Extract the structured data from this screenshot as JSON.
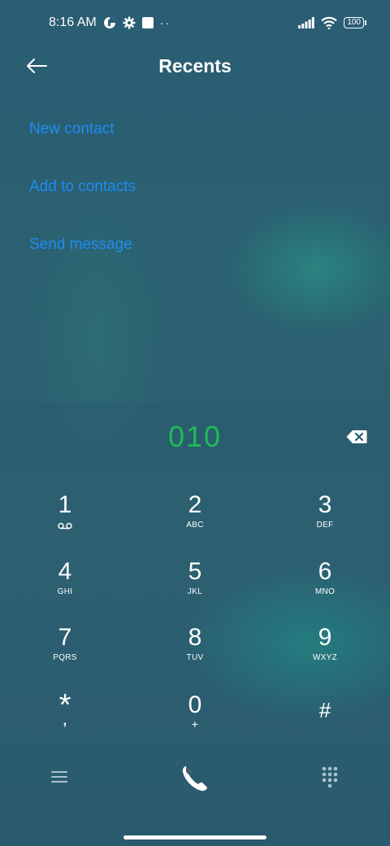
{
  "status_bar": {
    "time": "8:16 AM",
    "more_indicator": "··",
    "battery": "100"
  },
  "header": {
    "title": "Recents"
  },
  "actions": [
    {
      "label": "New contact"
    },
    {
      "label": "Add to contacts"
    },
    {
      "label": "Send message"
    }
  ],
  "dialer": {
    "number": "010",
    "number_color": "#1fbb55",
    "keys": [
      {
        "digit": "1",
        "letters": ""
      },
      {
        "digit": "2",
        "letters": "ABC"
      },
      {
        "digit": "3",
        "letters": "DEF"
      },
      {
        "digit": "4",
        "letters": "GHI"
      },
      {
        "digit": "5",
        "letters": "JKL"
      },
      {
        "digit": "6",
        "letters": "MNO"
      },
      {
        "digit": "7",
        "letters": "PQRS"
      },
      {
        "digit": "8",
        "letters": "TUV"
      },
      {
        "digit": "9",
        "letters": "WXYZ"
      },
      {
        "digit": "*",
        "letters": ","
      },
      {
        "digit": "0",
        "letters": "+"
      },
      {
        "digit": "#",
        "letters": ""
      }
    ]
  },
  "colors": {
    "accent": "#1f8cf2",
    "background": "#2a5e72"
  }
}
